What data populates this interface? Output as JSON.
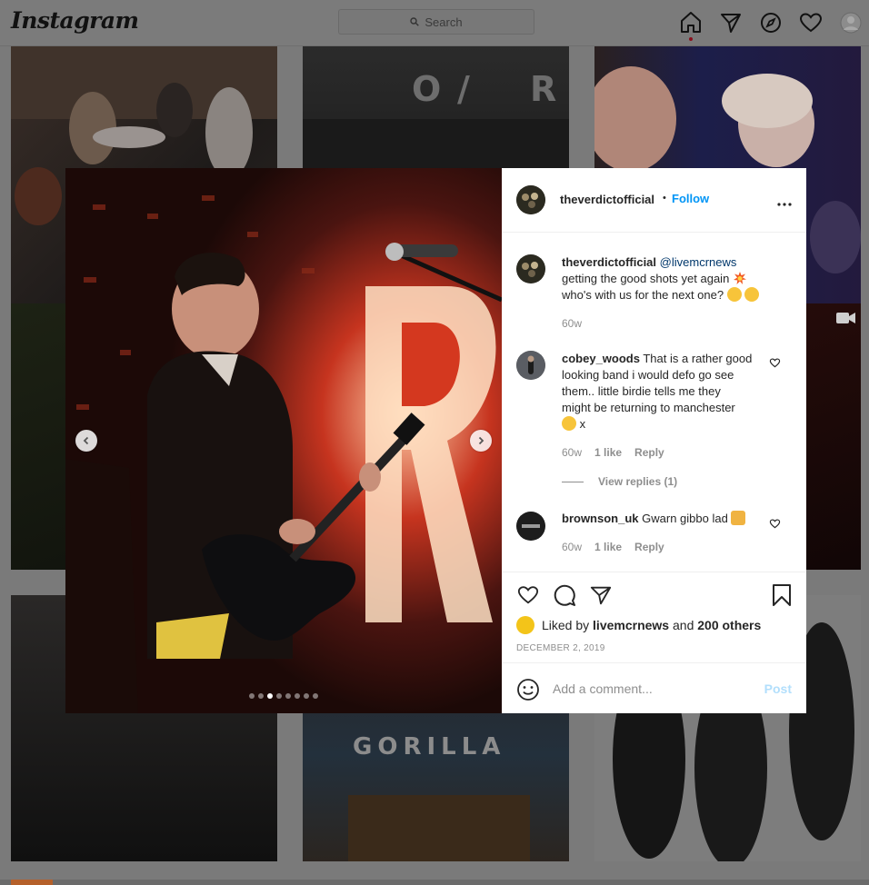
{
  "app": {
    "logo": "Instagram"
  },
  "search": {
    "placeholder": "Search"
  },
  "post": {
    "username": "theverdictofficial",
    "separator": "•",
    "follow_label": "Follow",
    "more_label": "•••",
    "caption": {
      "username": "theverdictofficial",
      "mention": "@livemcrnews",
      "line1": "getting the good shots yet again",
      "line2": "who's with us for the next one?",
      "time": "60w"
    },
    "comments": [
      {
        "username": "cobey_woods",
        "text": "That is a rather good looking band i would defo go see them.. little birdie tells me they might be returning to manchester",
        "text_tail": "x",
        "time": "60w",
        "likes": "1 like",
        "reply": "Reply",
        "view_replies": "View replies (1)"
      },
      {
        "username": "brownson_uk",
        "text": "Gwarn gibbo lad",
        "time": "60w",
        "likes": "1 like",
        "reply": "Reply"
      }
    ],
    "liked_by": {
      "prefix": "Liked by",
      "user": "livemcrnews",
      "and": "and",
      "others": "200 others"
    },
    "date": "DECEMBER 2, 2019",
    "comment_placeholder": "Add a comment...",
    "post_label": "Post",
    "carousel": {
      "count": 8,
      "active_index": 2
    }
  },
  "colors": {
    "accent": "#0095f6",
    "post_disabled": "#b2dffc",
    "notification": "#8a0f1d"
  }
}
